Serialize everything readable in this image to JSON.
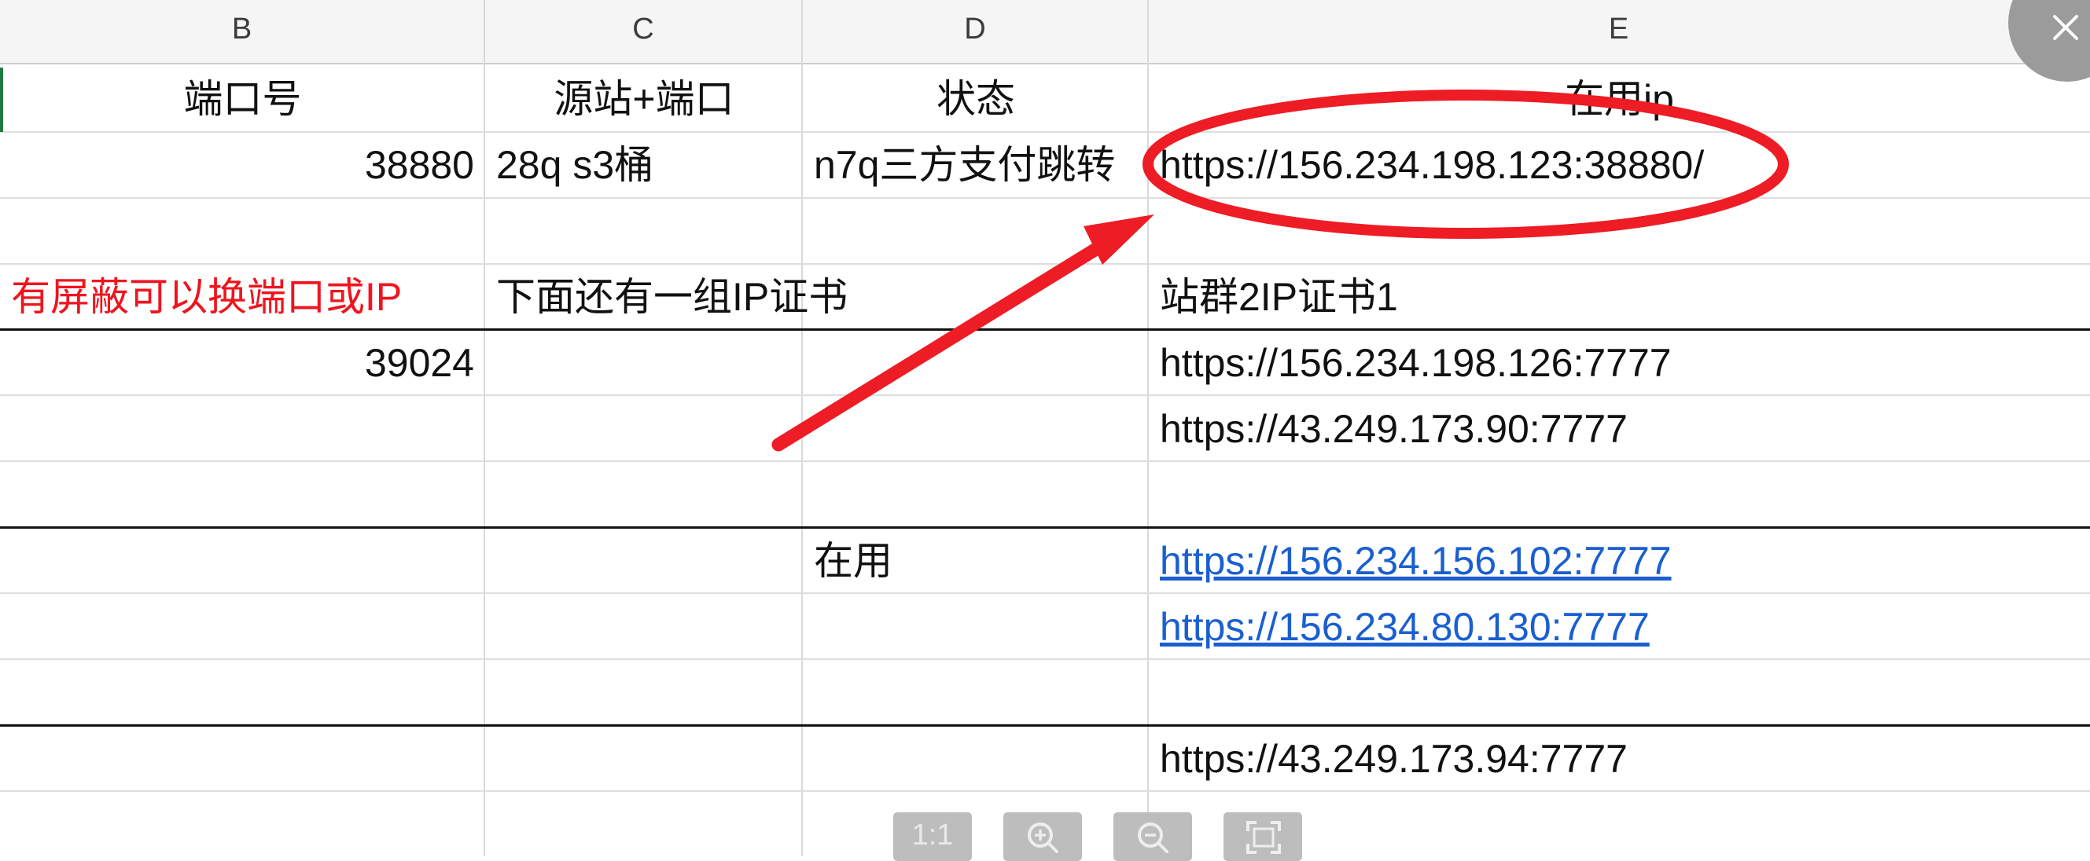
{
  "columns": [
    {
      "letter": "B"
    },
    {
      "letter": "C"
    },
    {
      "letter": "D"
    },
    {
      "letter": "E"
    }
  ],
  "rows": {
    "header": {
      "b": "端口号",
      "c": "源站+端口",
      "d": "状态",
      "e": "在用ip"
    },
    "r1": {
      "b": "38880",
      "c": "28q s3桶",
      "d": "n7q三方支付跳转",
      "e": "https://156.234.198.123:38880/"
    },
    "r3": {
      "b": "有屏蔽可以换端口或IP",
      "c": "下面还有一组IP证书",
      "e": "站群2IP证书1"
    },
    "r4": {
      "b": "39024",
      "e": "https://156.234.198.126:7777"
    },
    "r5": {
      "e": "https://43.249.173.90:7777"
    },
    "r7": {
      "d": "在用",
      "e": "https://156.234.156.102:7777"
    },
    "r8": {
      "e": "https://156.234.80.130:7777"
    },
    "r10": {
      "e": "https://43.249.173.94:7777"
    }
  },
  "colors": {
    "warning_text": "#f0141e",
    "link": "#1a5fd0",
    "annotation": "#ee1c25"
  },
  "toolbar": {
    "actual_size_label": "1:1",
    "zoom_in_icon": "zoom-in-icon",
    "zoom_out_icon": "zoom-out-icon",
    "fit_icon": "fit-screen-icon"
  },
  "close_icon": "close-icon"
}
